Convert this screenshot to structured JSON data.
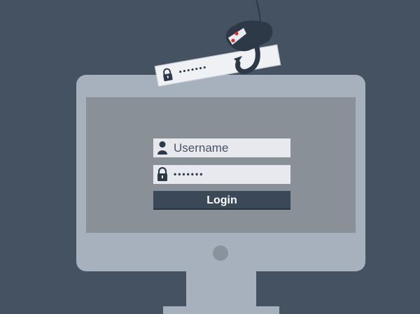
{
  "login_form": {
    "username_placeholder": "Username",
    "password_mask": "•••••••",
    "login_label": "Login"
  },
  "phished_credential": {
    "password_mask": "•••••••"
  },
  "colors": {
    "background": "#455262",
    "monitor_frame": "#a6b1bd",
    "monitor_screen": "#8a9098",
    "field": "#e7e9ee",
    "button": "#3b4858",
    "hook_accent": "#d0312d"
  },
  "icons": [
    "user-icon",
    "lock-icon",
    "fishing-hook-icon",
    "power-button-icon"
  ]
}
